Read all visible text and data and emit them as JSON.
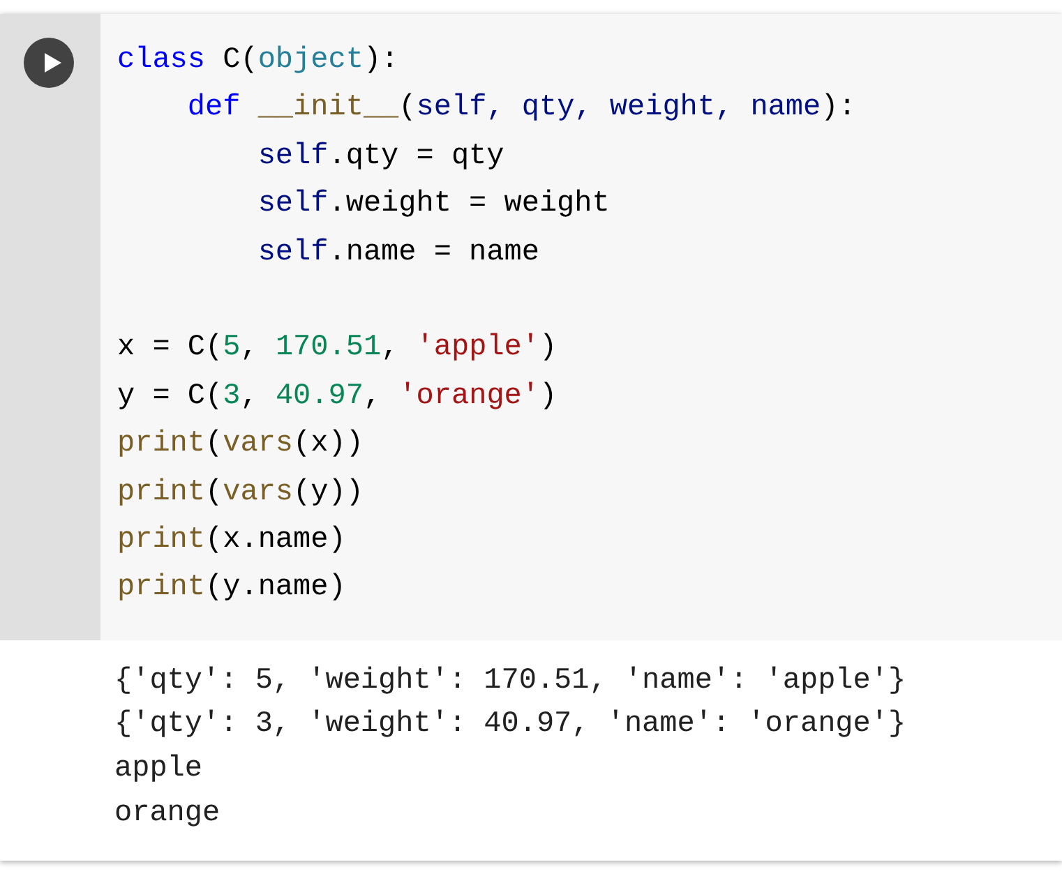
{
  "cell": {
    "run_button": {
      "kind": "play"
    },
    "code_lines": [
      {
        "kind": "code",
        "tokens": [
          {
            "kind": "keyword",
            "text": "class"
          },
          {
            "kind": "plain",
            "text": " C("
          },
          {
            "kind": "builtin",
            "text": "object"
          },
          {
            "kind": "plain",
            "text": "):"
          }
        ]
      },
      {
        "kind": "code",
        "tokens": [
          {
            "kind": "keyword",
            "text": "    def "
          },
          {
            "kind": "function",
            "text": "__init__"
          },
          {
            "kind": "plain",
            "text": "("
          },
          {
            "kind": "variable",
            "text": "self, qty, weight, name"
          },
          {
            "kind": "plain",
            "text": "):"
          }
        ]
      },
      {
        "kind": "code",
        "tokens": [
          {
            "kind": "variable",
            "text": "        self"
          },
          {
            "kind": "plain",
            "text": ".qty = qty"
          }
        ]
      },
      {
        "kind": "code",
        "tokens": [
          {
            "kind": "variable",
            "text": "        self"
          },
          {
            "kind": "plain",
            "text": ".weight = weight"
          }
        ]
      },
      {
        "kind": "code",
        "tokens": [
          {
            "kind": "variable",
            "text": "        self"
          },
          {
            "kind": "plain",
            "text": ".name = name"
          }
        ]
      },
      {
        "kind": "blank"
      },
      {
        "kind": "code",
        "tokens": [
          {
            "kind": "plain",
            "text": "x = C("
          },
          {
            "kind": "number",
            "text": "5"
          },
          {
            "kind": "plain",
            "text": ", "
          },
          {
            "kind": "number",
            "text": "170.51"
          },
          {
            "kind": "plain",
            "text": ", "
          },
          {
            "kind": "string",
            "text": "'apple'"
          },
          {
            "kind": "plain",
            "text": ")"
          }
        ]
      },
      {
        "kind": "code",
        "tokens": [
          {
            "kind": "plain",
            "text": "y = C("
          },
          {
            "kind": "number",
            "text": "3"
          },
          {
            "kind": "plain",
            "text": ", "
          },
          {
            "kind": "number",
            "text": "40.97"
          },
          {
            "kind": "plain",
            "text": ", "
          },
          {
            "kind": "string",
            "text": "'orange'"
          },
          {
            "kind": "plain",
            "text": ")"
          }
        ]
      },
      {
        "kind": "code",
        "tokens": [
          {
            "kind": "function",
            "text": "print"
          },
          {
            "kind": "plain",
            "text": "("
          },
          {
            "kind": "function",
            "text": "vars"
          },
          {
            "kind": "plain",
            "text": "(x))"
          }
        ]
      },
      {
        "kind": "code",
        "tokens": [
          {
            "kind": "function",
            "text": "print"
          },
          {
            "kind": "plain",
            "text": "("
          },
          {
            "kind": "function",
            "text": "vars"
          },
          {
            "kind": "plain",
            "text": "(y))"
          }
        ]
      },
      {
        "kind": "code",
        "tokens": [
          {
            "kind": "function",
            "text": "print"
          },
          {
            "kind": "plain",
            "text": "(x.name)"
          }
        ]
      },
      {
        "kind": "code",
        "tokens": [
          {
            "kind": "function",
            "text": "print"
          },
          {
            "kind": "plain",
            "text": "(y.name)"
          }
        ]
      }
    ],
    "output_lines": [
      "{'qty': 5, 'weight': 170.51, 'name': 'apple'}",
      "{'qty': 3, 'weight': 40.97, 'name': 'orange'}",
      "apple",
      "orange"
    ]
  }
}
